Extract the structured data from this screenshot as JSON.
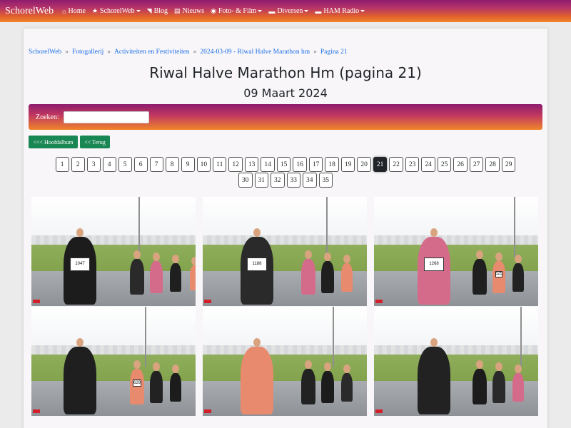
{
  "navbar": {
    "brand": "SchorelWeb",
    "items": [
      {
        "label": "Home",
        "icon": "home-icon",
        "glyph": "⌂",
        "dropdown": false
      },
      {
        "label": "SchorelWeb",
        "icon": "star-icon",
        "glyph": "★",
        "dropdown": true
      },
      {
        "label": "Blog",
        "icon": "rss-icon",
        "glyph": "◥",
        "dropdown": false
      },
      {
        "label": "Nieuws",
        "icon": "newspaper-icon",
        "glyph": "▤",
        "dropdown": false
      },
      {
        "label": "Foto- & Film",
        "icon": "camera-icon",
        "glyph": "◉",
        "dropdown": true
      },
      {
        "label": "Diversen",
        "icon": "folder-icon",
        "glyph": "▬",
        "dropdown": true
      },
      {
        "label": "HAM Radio",
        "icon": "folder-icon",
        "glyph": "▬",
        "dropdown": true
      }
    ]
  },
  "breadcrumb": [
    "SchorelWeb",
    "Fotogallerij",
    "Activiteiten en Festiviteiten",
    "2024-03-09 - Riwal Halve Marathon hm",
    "Pagina 21"
  ],
  "breadcrumb_separator": "»",
  "page": {
    "title": "Riwal Halve Marathon Hm (pagina 21)",
    "subtitle": "09 Maart 2024"
  },
  "search": {
    "label": "Zoeken:",
    "value": "",
    "placeholder": ""
  },
  "buttons": {
    "main_album": "<<< Hoofdalbum",
    "back": "<< Terug"
  },
  "pagination": {
    "current": 21,
    "rows": [
      [
        "1",
        "2",
        "3",
        "4",
        "5",
        "6",
        "7",
        "8",
        "9",
        "10",
        "11",
        "12",
        "13",
        "14",
        "15",
        "16",
        "17",
        "18",
        "19",
        "20",
        "21",
        "22",
        "23",
        "24",
        "25",
        "26",
        "27",
        "28",
        "29"
      ],
      [
        "30",
        "31",
        "32",
        "33",
        "34",
        "35"
      ]
    ]
  },
  "colors": {
    "navbar_gradient": [
      "#8e1c6e",
      "#f0862a"
    ],
    "link": "#1a6ee8",
    "button_green": "#198754",
    "active_page": "#212529"
  },
  "gallery": {
    "photos": [
      {
        "bibs": [
          "1047",
          "",
          "",
          "",
          ""
        ]
      },
      {
        "bibs": [
          "1188",
          "",
          "",
          ""
        ]
      },
      {
        "bibs": [
          "1268",
          "",
          "625",
          ""
        ]
      },
      {
        "bibs": [
          "",
          "629",
          "",
          ""
        ]
      },
      {
        "bibs": [
          "",
          "",
          "",
          ""
        ]
      },
      {
        "bibs": [
          "",
          "",
          "",
          ""
        ]
      }
    ]
  }
}
